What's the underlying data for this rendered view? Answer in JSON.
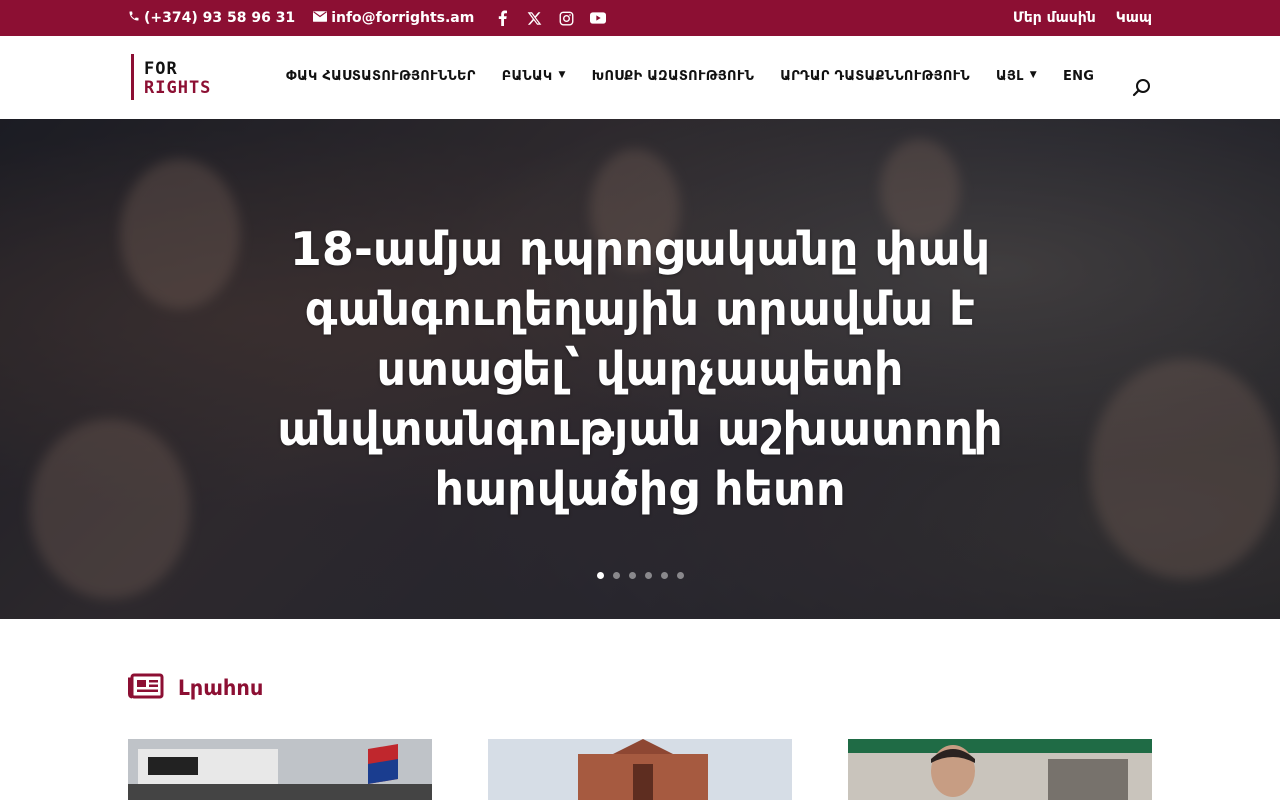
{
  "topbar": {
    "phone": "(+374) 93 58 96 31",
    "email": "info@forrights.am",
    "social_icons": [
      "facebook-icon",
      "x-icon",
      "instagram-icon",
      "youtube-icon"
    ],
    "links": [
      "Մեր մասին",
      "Կապ"
    ]
  },
  "header": {
    "logo": {
      "line1": "FOR",
      "line2": "RIGHTS"
    },
    "nav": [
      {
        "label": "ՓԱԿ ՀԱՍՏԱՏՈՒԹՅՈՒՆՆԵՐ",
        "has_submenu": false
      },
      {
        "label": "ԲԱՆԱԿ",
        "has_submenu": true
      },
      {
        "label": "ԽՈՍՔԻ ԱԶԱՏՈՒԹՅՈՒՆ",
        "has_submenu": false
      },
      {
        "label": "ԱՐԴԱՐ ԴԱՏԱՔՆՆՈՒԹՅՈՒՆ",
        "has_submenu": false
      },
      {
        "label": "ԱՅԼ",
        "has_submenu": true
      },
      {
        "label": "ENG",
        "has_submenu": false
      }
    ]
  },
  "hero": {
    "title": "18-ամյա դպրոցականը փակ գանգուղեղային տրավմա է ստացել՝ վարչապետի անվտանգության աշխատողի հարվածից հետո",
    "slide_count": 6,
    "active_slide": 0
  },
  "news": {
    "title": "Լրահոս",
    "cards": 3
  },
  "colors": {
    "brand": "#8c0f33",
    "text": "#111111",
    "white": "#ffffff"
  }
}
